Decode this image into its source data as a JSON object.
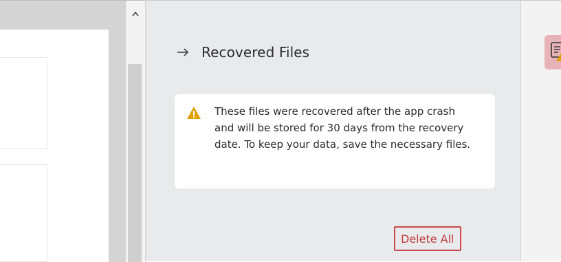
{
  "scrollbar": {
    "up_icon": "chevron-up-icon"
  },
  "recovery_pane": {
    "header_icon": "arrow-right-icon",
    "title": "Recovered Files",
    "notice": {
      "icon": "warning-icon",
      "text": "These files were recovered after the app crash and will be stored for 30 days from the recovery date. To keep your data, save the necessary files."
    },
    "delete_all_label": "Delete All"
  },
  "right_toolbar": {
    "recovery_icon": "document-warning-icon"
  },
  "colors": {
    "pane_background": "#e9eaec",
    "warning_accent": "#e0a100",
    "delete_button_accent": "#c94a4a",
    "recovery_tool_highlight": "#e8b3b8"
  }
}
